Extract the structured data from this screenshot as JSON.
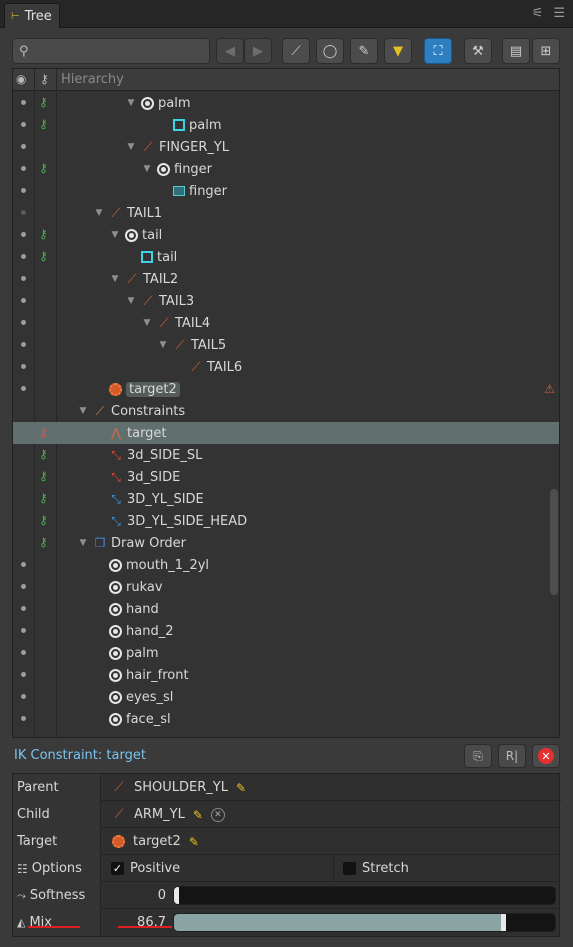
{
  "tab": {
    "title": "Tree"
  },
  "tree": {
    "header": "Hierarchy",
    "rows": [
      {
        "label": "palm",
        "icon": "slot-icon",
        "indent": 4,
        "tri": true,
        "dot": true,
        "key": "green"
      },
      {
        "label": "palm",
        "icon": "mesh-icon",
        "indent": 6,
        "tri": false,
        "dot": true,
        "key": "green"
      },
      {
        "label": "FINGER_YL",
        "icon": "bone-icon",
        "indent": 4,
        "tri": true,
        "dot": true,
        "key": ""
      },
      {
        "label": "finger",
        "icon": "slot-icon",
        "indent": 5,
        "tri": true,
        "dot": true,
        "key": "green"
      },
      {
        "label": "finger",
        "icon": "region-icon",
        "indent": 6,
        "tri": false,
        "dot": true,
        "key": ""
      },
      {
        "label": "TAIL1",
        "icon": "bone-icon",
        "indent": 2,
        "tri": true,
        "dot": "dim",
        "key": ""
      },
      {
        "label": "tail",
        "icon": "slot-icon",
        "indent": 3,
        "tri": true,
        "dot": true,
        "key": "green"
      },
      {
        "label": "tail",
        "icon": "mesh-icon",
        "indent": 4,
        "tri": false,
        "dot": true,
        "key": "green"
      },
      {
        "label": "TAIL2",
        "icon": "bone-icon",
        "indent": 3,
        "tri": true,
        "dot": true,
        "key": ""
      },
      {
        "label": "TAIL3",
        "icon": "bone-icon",
        "indent": 4,
        "tri": true,
        "dot": true,
        "key": ""
      },
      {
        "label": "TAIL4",
        "icon": "bone-icon",
        "indent": 5,
        "tri": true,
        "dot": true,
        "key": ""
      },
      {
        "label": "TAIL5",
        "icon": "bone-icon",
        "indent": 6,
        "tri": true,
        "dot": true,
        "key": ""
      },
      {
        "label": "TAIL6",
        "icon": "bone-icon",
        "indent": 7,
        "tri": false,
        "dot": true,
        "key": ""
      },
      {
        "label": "target2",
        "icon": "target-icon",
        "indent": 2,
        "tri": false,
        "dot": true,
        "key": "",
        "pill": true,
        "mark": true
      },
      {
        "label": "Constraints",
        "icon": "constraints-icon",
        "indent": 1,
        "tri": true,
        "dot": false,
        "key": ""
      },
      {
        "label": "target",
        "icon": "ik-constraint-icon",
        "indent": 2,
        "tri": false,
        "dot": false,
        "key": "red",
        "selected": true
      },
      {
        "label": "3d_SIDE_SL",
        "icon": "transform-constraint-red-icon",
        "indent": 2,
        "tri": false,
        "dot": false,
        "key": "green"
      },
      {
        "label": "3d_SIDE",
        "icon": "transform-constraint-red-icon",
        "indent": 2,
        "tri": false,
        "dot": false,
        "key": "green"
      },
      {
        "label": "3D_YL_SIDE",
        "icon": "transform-constraint-blue-icon",
        "indent": 2,
        "tri": false,
        "dot": false,
        "key": "green"
      },
      {
        "label": "3D_YL_SIDE_HEAD",
        "icon": "transform-constraint-blue-icon",
        "indent": 2,
        "tri": false,
        "dot": false,
        "key": "green"
      },
      {
        "label": "Draw Order",
        "icon": "draw-order-icon",
        "indent": 1,
        "tri": true,
        "dot": false,
        "key": "green"
      },
      {
        "label": "mouth_1_2yl",
        "icon": "slot-icon",
        "indent": 2,
        "tri": false,
        "dot": true,
        "key": ""
      },
      {
        "label": "rukav",
        "icon": "slot-icon",
        "indent": 2,
        "tri": false,
        "dot": true,
        "key": ""
      },
      {
        "label": "hand",
        "icon": "slot-icon",
        "indent": 2,
        "tri": false,
        "dot": true,
        "key": ""
      },
      {
        "label": "hand_2",
        "icon": "slot-icon",
        "indent": 2,
        "tri": false,
        "dot": true,
        "key": ""
      },
      {
        "label": "palm",
        "icon": "slot-icon",
        "indent": 2,
        "tri": false,
        "dot": true,
        "key": ""
      },
      {
        "label": "hair_front",
        "icon": "slot-icon",
        "indent": 2,
        "tri": false,
        "dot": true,
        "key": ""
      },
      {
        "label": "eyes_sl",
        "icon": "slot-icon",
        "indent": 2,
        "tri": false,
        "dot": true,
        "key": ""
      },
      {
        "label": "face_sl",
        "icon": "slot-icon",
        "indent": 2,
        "tri": false,
        "dot": true,
        "key": ""
      }
    ]
  },
  "constraint": {
    "title": "IK Constraint: target",
    "parent_label": "Parent",
    "parent_value": "SHOULDER_YL",
    "child_label": "Child",
    "child_value": "ARM_YL",
    "target_label": "Target",
    "target_value": "target2",
    "options_label": "Options",
    "positive_label": "Positive",
    "positive_checked": true,
    "stretch_label": "Stretch",
    "stretch_checked": false,
    "softness_label": "Softness",
    "softness_value": "0",
    "softness_fraction": 0,
    "mix_label": "Mix",
    "mix_value": "86.7",
    "mix_fraction": 0.867
  },
  "colors": {
    "accent": "#2e7fc1",
    "selection": "#61706f",
    "title": "#7cc4f0",
    "delete": "#e53030"
  }
}
